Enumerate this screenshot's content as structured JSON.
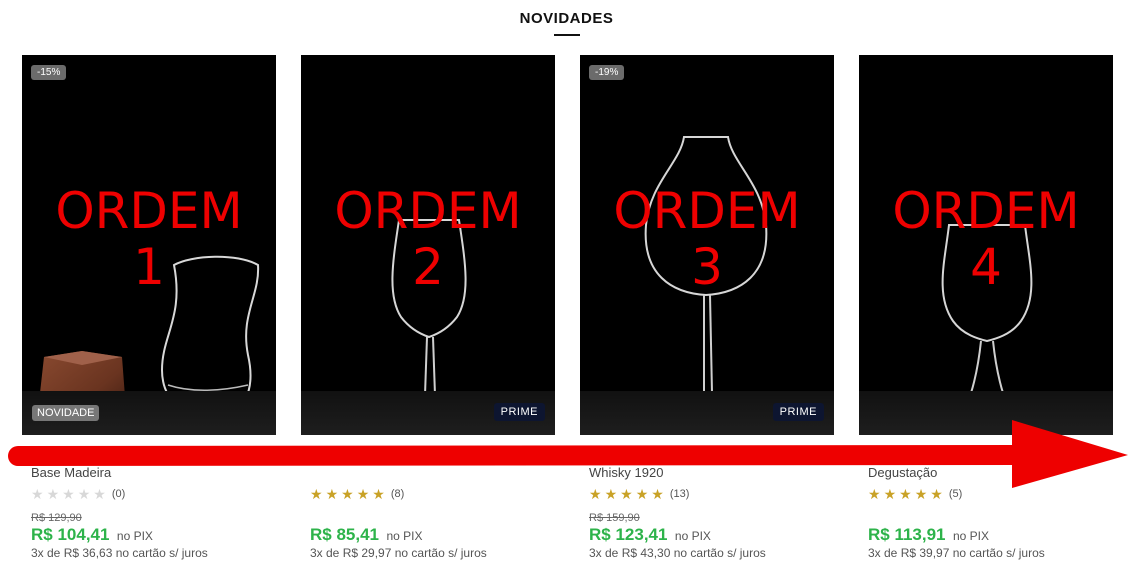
{
  "section": {
    "title": "NOVIDADES"
  },
  "overlay_label": "ORDEM",
  "colors": {
    "price": "#2db34a",
    "star": "#c9a227",
    "overlay": "#ee0000",
    "prime": "#0d1530"
  },
  "products": [
    {
      "order": "1",
      "discount": "-15%",
      "badge": "NOVIDADE",
      "name": "Base Madeira",
      "rating_stars": 0,
      "reviews": "(0)",
      "old_price": "R$ 129,90",
      "price": "R$ 104,41",
      "pix": "no PIX",
      "installments": "3x de R$ 36,63 no cartão s/ juros"
    },
    {
      "order": "2",
      "badge": "PRIME",
      "name": "",
      "rating_stars": 5,
      "reviews": "(8)",
      "price": "R$ 85,41",
      "pix": "no PIX",
      "installments": "3x de R$ 29,97 no cartão s/ juros"
    },
    {
      "order": "3",
      "discount": "-19%",
      "badge": "PRIME",
      "name": "Whisky 1920",
      "rating_stars": 5,
      "reviews": "(13)",
      "old_price": "R$ 159,90",
      "price": "R$ 123,41",
      "pix": "no PIX",
      "installments": "3x de R$ 43,30 no cartão s/ juros"
    },
    {
      "order": "4",
      "name": "Degustação",
      "rating_stars": 5,
      "reviews": "(5)",
      "price": "R$ 113,91",
      "pix": "no PIX",
      "installments": "3x de R$ 39,97 no cartão s/ juros"
    }
  ]
}
